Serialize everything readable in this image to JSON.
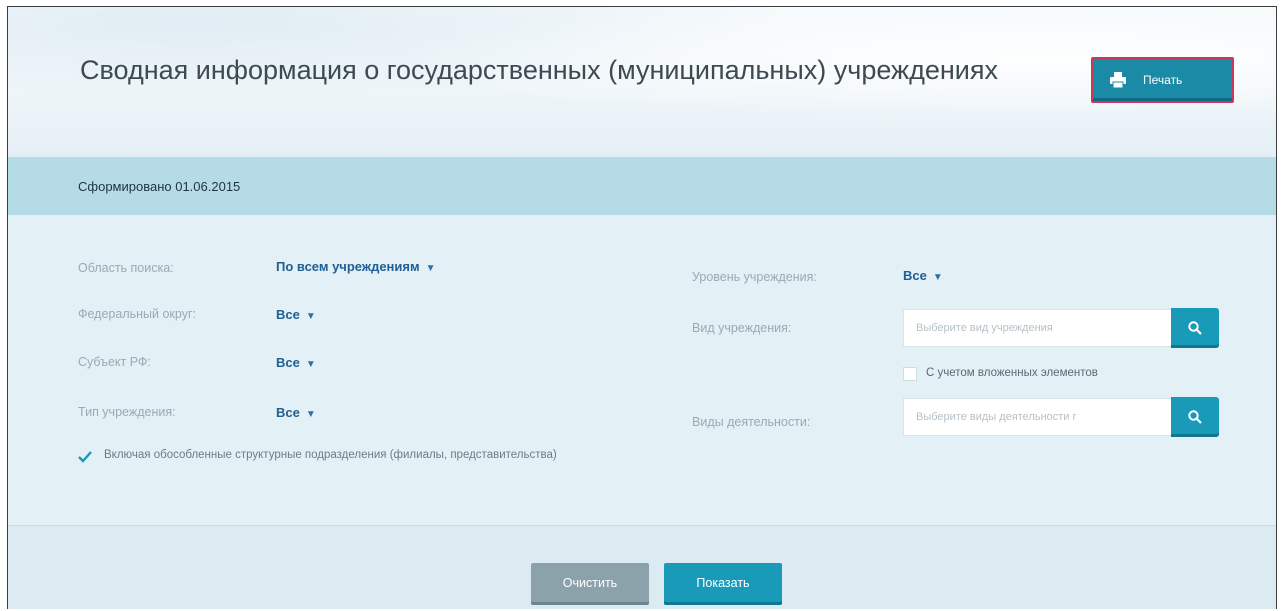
{
  "header": {
    "title": "Сводная информация о государственных (муниципальных) учреждениях",
    "print_label": "Печать"
  },
  "band": {
    "generated": "Сформировано 01.06.2015"
  },
  "filters_left": [
    {
      "label": "Область поиска:",
      "value": "По всем учреждениям"
    },
    {
      "label": "Федеральный округ:",
      "value": "Все"
    },
    {
      "label": "Субъект РФ:",
      "value": "Все"
    },
    {
      "label": "Тип учреждения:",
      "value": "Все"
    }
  ],
  "include_subdivisions": {
    "checked": true,
    "text": "Включая обособленные структурные подразделения (филиалы, представительства)"
  },
  "filters_right": {
    "level_label": "Уровень учреждения:",
    "level_value": "Все",
    "kind_label": "Вид учреждения:",
    "kind_placeholder": "Выберите вид учреждения",
    "nested_label": "С учетом вложенных элементов",
    "activities_label": "Виды деятельности:",
    "activities_placeholder": "Выберите виды деятельности г"
  },
  "footer": {
    "clear_label": "Очистить",
    "show_label": "Показать"
  },
  "colors": {
    "accent": "#1a9ab9",
    "print_border": "#c9385a",
    "link": "#1f5f93"
  }
}
